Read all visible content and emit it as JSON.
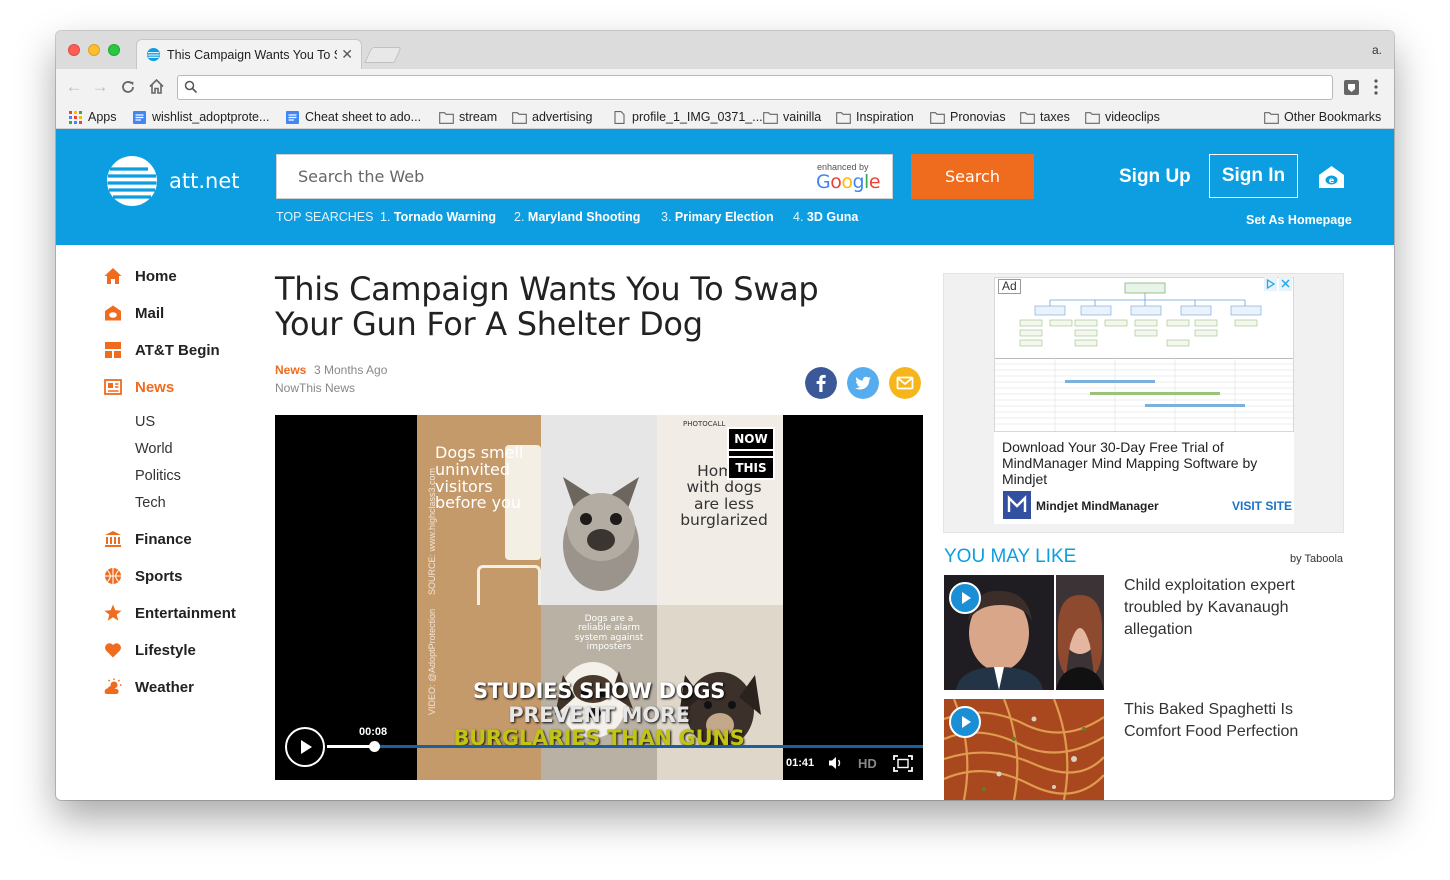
{
  "browser": {
    "tab_title": "This Campaign Wants You To Swap Your Gun For A Shelter Dog",
    "profile_label": "a.",
    "address_value": "",
    "bookmarks": [
      {
        "label": "Apps",
        "icon": "apps-grid-icon"
      },
      {
        "label": "wishlist_adoptprote...",
        "icon": "doc-icon"
      },
      {
        "label": "Cheat sheet to ado...",
        "icon": "doc-icon"
      },
      {
        "label": "stream",
        "icon": "folder-icon"
      },
      {
        "label": "advertising",
        "icon": "folder-icon"
      },
      {
        "label": "profile_1_IMG_0371_...",
        "icon": "page-icon"
      },
      {
        "label": "vainilla",
        "icon": "folder-icon"
      },
      {
        "label": "Inspiration",
        "icon": "folder-icon"
      },
      {
        "label": "Pronovias",
        "icon": "folder-icon"
      },
      {
        "label": "taxes",
        "icon": "folder-icon"
      },
      {
        "label": "videoclips",
        "icon": "folder-icon"
      }
    ],
    "other_bookmarks": "Other Bookmarks"
  },
  "header": {
    "logo_text": "att.net",
    "search_placeholder": "Search the Web",
    "enhanced_by": "enhanced by",
    "google_label": "Google",
    "search_button": "Search",
    "sign_up": "Sign Up",
    "sign_in": "Sign In",
    "set_homepage": "Set As Homepage",
    "top_searches_label": "TOP SEARCHES",
    "top_searches": [
      {
        "num": "1.",
        "term": "Tornado Warning"
      },
      {
        "num": "2.",
        "term": "Maryland Shooting"
      },
      {
        "num": "3.",
        "term": "Primary Election"
      },
      {
        "num": "4.",
        "term": "3D Guna"
      }
    ]
  },
  "nav": {
    "items": [
      {
        "label": "Home",
        "icon": "home-icon"
      },
      {
        "label": "Mail",
        "icon": "mail-icon"
      },
      {
        "label": "AT&T Begin",
        "icon": "grid-icon"
      },
      {
        "label": "News",
        "icon": "newspaper-icon",
        "active": true
      },
      {
        "label": "Finance",
        "icon": "bank-icon"
      },
      {
        "label": "Sports",
        "icon": "basketball-icon"
      },
      {
        "label": "Entertainment",
        "icon": "star-icon"
      },
      {
        "label": "Lifestyle",
        "icon": "heart-icon"
      },
      {
        "label": "Weather",
        "icon": "sun-cloud-icon"
      }
    ],
    "news_subitems": [
      "US",
      "World",
      "Politics",
      "Tech"
    ]
  },
  "article": {
    "title": "This Campaign Wants You To Swap Your Gun For A Shelter Dog",
    "category": "News",
    "age": "3 Months Ago",
    "source": "NowThis News",
    "share_icons": [
      "facebook-icon",
      "twitter-icon",
      "email-icon"
    ]
  },
  "video": {
    "poster_left_text": "Dogs smell uninvited visitors before you",
    "poster_right_text": "Homes with dogs are less burglarized",
    "poster_bottom_text": "Dogs are a reliable alarm system against imposters",
    "photocall": "PHOTOCALL",
    "watermark_source": "SOURCE: www.highclass3.com",
    "watermark_video": "VIDEO: @AdoptProtection",
    "brand_top": "NOW",
    "brand_bottom": "THIS",
    "caption_line1": "STUDIES SHOW DOGS",
    "caption_line2": "PREVENT MORE",
    "caption_line3": "BURGLARIES THAN GUNS",
    "current_time": "00:08",
    "total_time": "01:41",
    "progress_fraction": 0.079,
    "hd_label": "HD"
  },
  "ad": {
    "label": "Ad",
    "headline": "Download Your 30-Day Free Trial of MindManager Mind Mapping Software by Mindjet",
    "brand": "Mindjet MindManager",
    "cta": "VISIT SITE"
  },
  "recommendations": {
    "heading": "YOU MAY LIKE",
    "provider": "by Taboola",
    "items": [
      {
        "title": "Child exploitation expert troubled by Kavanaugh allegation"
      },
      {
        "title": "This Baked Spaghetti Is Comfort Food Perfection"
      }
    ]
  },
  "colors": {
    "att_blue": "#0c9ee0",
    "att_orange": "#ef6c1e",
    "facebook": "#3b5998",
    "twitter": "#55acee",
    "email": "#f7b51c"
  }
}
